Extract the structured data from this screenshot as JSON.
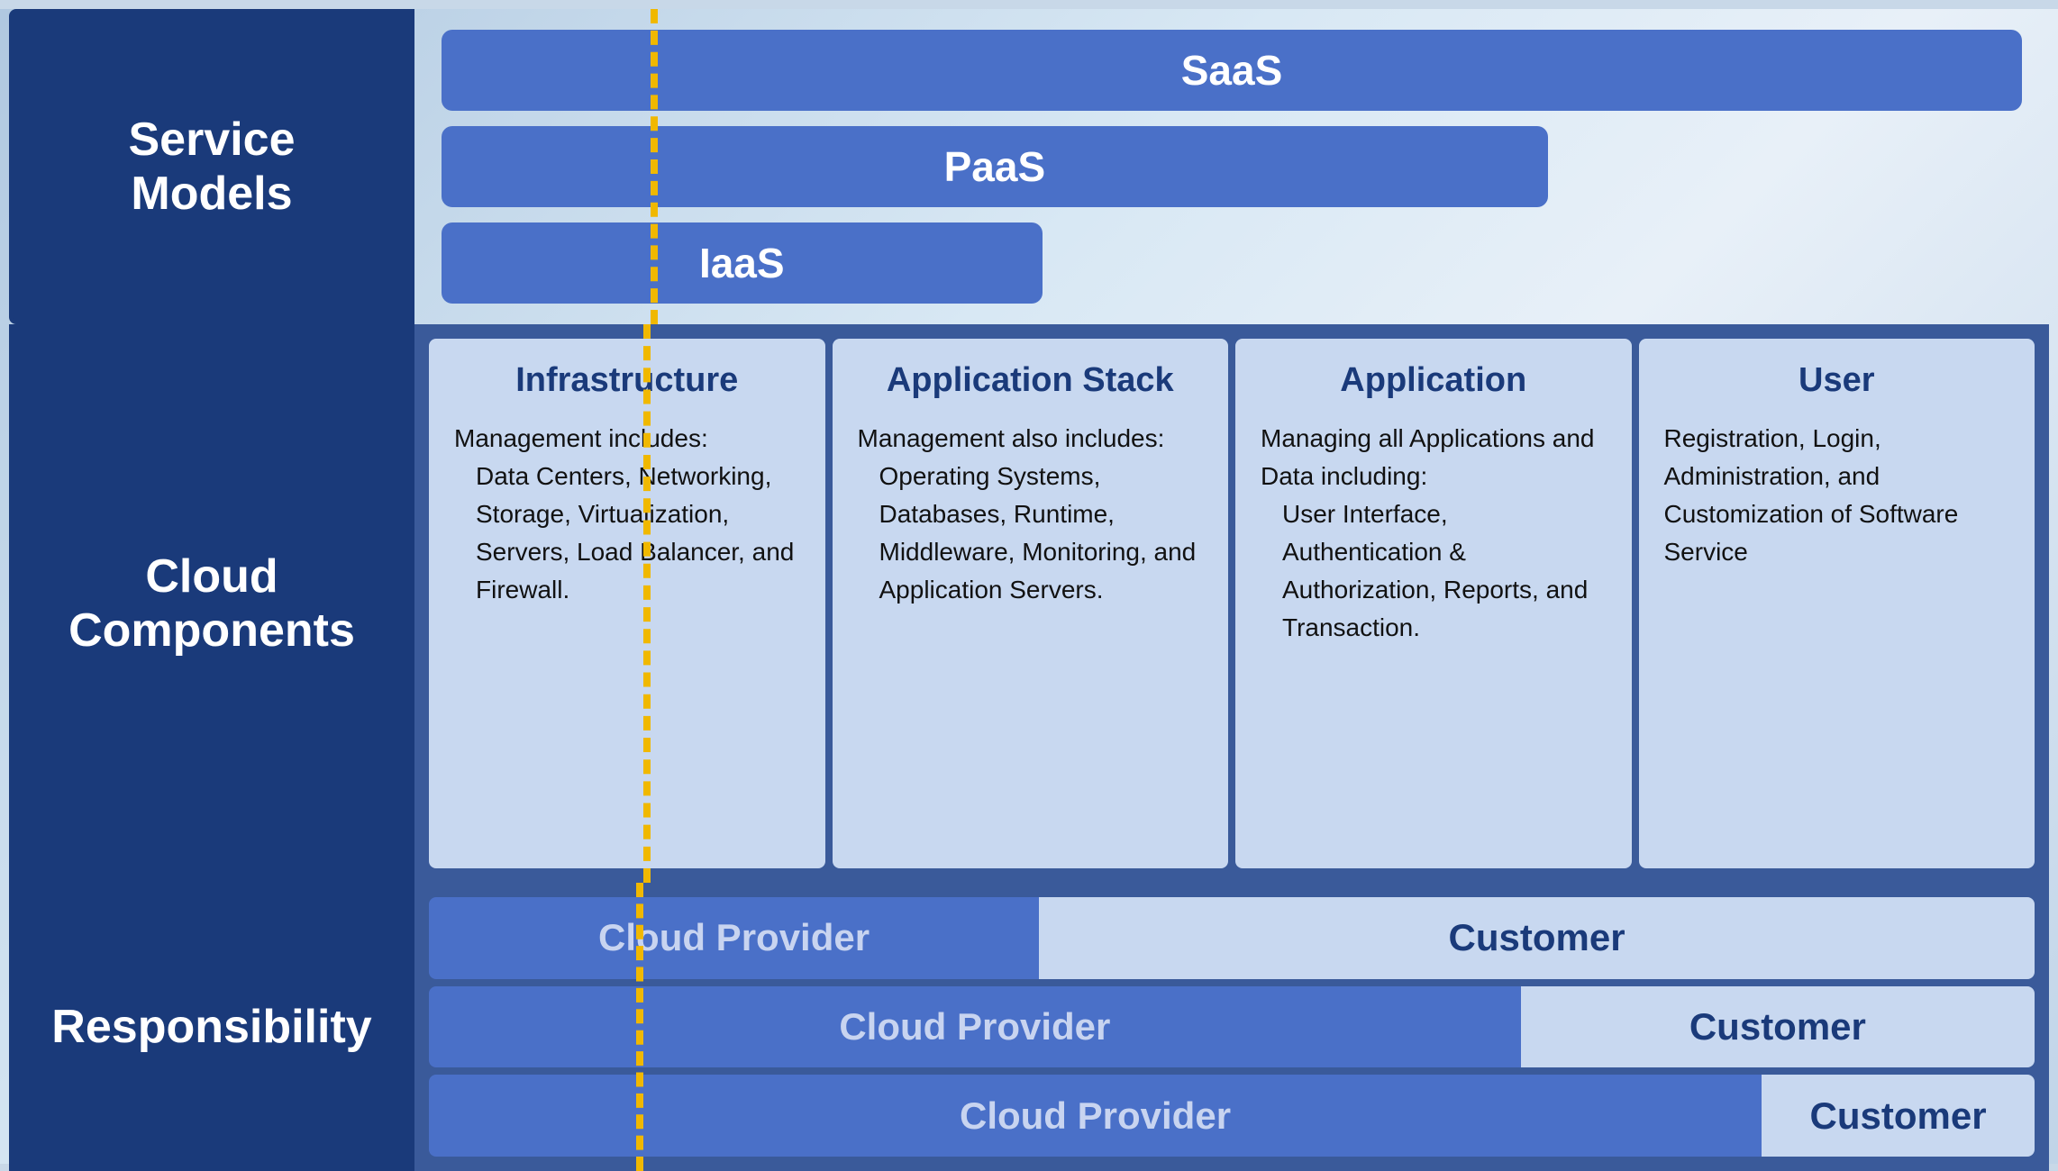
{
  "labels": {
    "service_models": "Service\nModels",
    "cloud_components": "Cloud\nComponents",
    "responsibility": "Responsibility"
  },
  "service_models": {
    "saas": "SaaS",
    "paas": "PaaS",
    "iaas": "IaaS"
  },
  "cloud_components": {
    "infrastructure": {
      "title": "Infrastructure",
      "body": "Management includes:",
      "items": "Data Centers, Networking, Storage, Virtualization, Servers, Load Balancer, and Firewall."
    },
    "application_stack": {
      "title": "Application Stack",
      "body": "Management also includes:",
      "items": "Operating Systems, Databases, Runtime, Middleware, Monitoring, and Application Servers."
    },
    "application": {
      "title": "Application",
      "body": "Managing all Applications and Data including:",
      "items": "User Interface, Authentication & Authorization, Reports, and Transaction."
    },
    "user": {
      "title": "User",
      "body": "Registration, Login, Administration, and Customization of Software Service"
    }
  },
  "responsibility": {
    "iaas_provider": "Cloud Provider",
    "iaas_customer": "Customer",
    "paas_provider": "Cloud Provider",
    "paas_customer": "Customer",
    "saas_provider": "Cloud Provider",
    "saas_customer": "Customer"
  }
}
